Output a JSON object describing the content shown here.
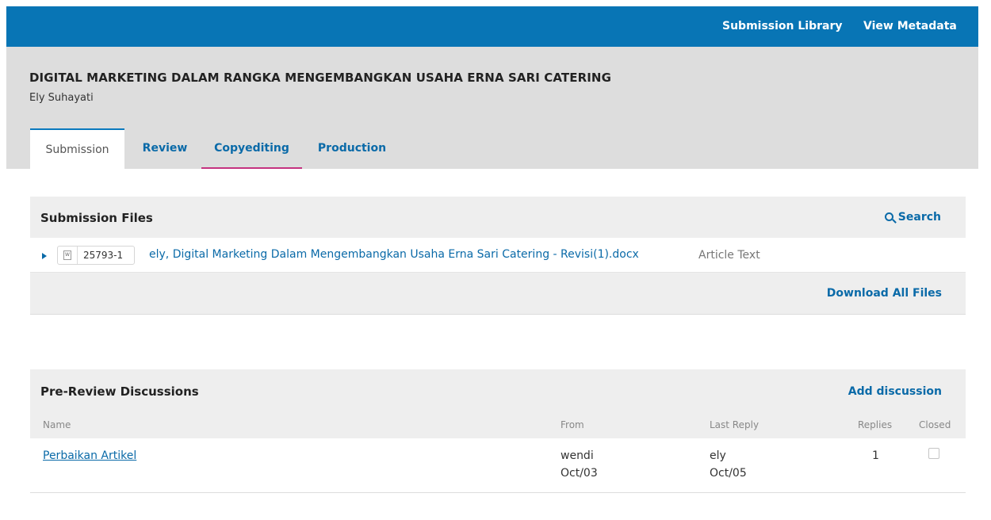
{
  "topbar": {
    "submission_library": "Submission Library",
    "view_metadata": "View Metadata"
  },
  "submission": {
    "title": "DIGITAL MARKETING DALAM RANGKA MENGEMBANGKAN USAHA ERNA SARI CATERING",
    "author": "Ely Suhayati"
  },
  "tabs": [
    {
      "label": "Submission",
      "active": true
    },
    {
      "label": "Review"
    },
    {
      "label": "Copyediting"
    },
    {
      "label": "Production"
    }
  ],
  "files": {
    "title": "Submission Files",
    "search_label": "Search",
    "rows": [
      {
        "id": "25793-1",
        "name": "ely, Digital Marketing Dalam Mengembangkan Usaha Erna Sari Catering - Revisi(1).docx",
        "type": "Article Text",
        "icon": "docx-file-icon"
      }
    ],
    "download_all": "Download All Files"
  },
  "discussions": {
    "title": "Pre-Review Discussions",
    "add_label": "Add discussion",
    "columns": {
      "name": "Name",
      "from": "From",
      "last_reply": "Last Reply",
      "replies": "Replies",
      "closed": "Closed"
    },
    "rows": [
      {
        "name": "Perbaikan Artikel",
        "from_user": "wendi",
        "from_date": "Oct/03",
        "reply_user": "ely",
        "reply_date": "Oct/05",
        "replies": "1",
        "closed": false
      }
    ]
  },
  "colors": {
    "primary": "#0875b5",
    "link": "#0a6aa8",
    "tab_underline": "#c4327f",
    "header_bg": "#dddddd",
    "panel_bg": "#eeeeee"
  }
}
